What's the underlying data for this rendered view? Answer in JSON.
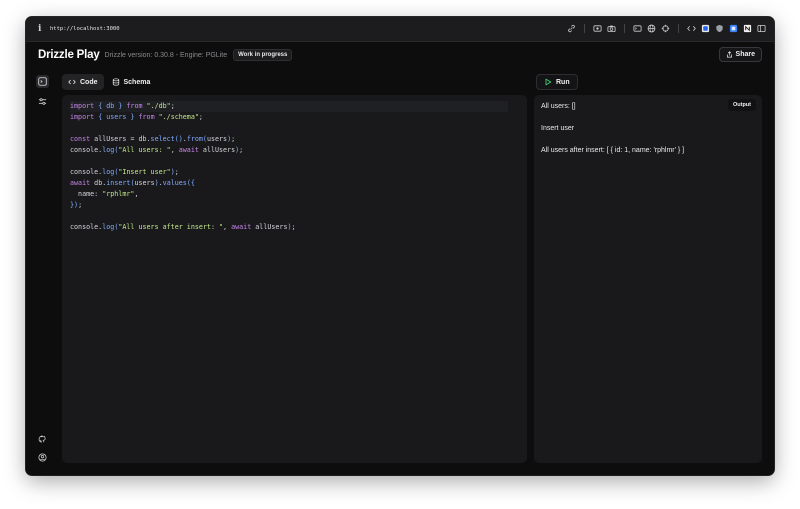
{
  "browser": {
    "url": "http://localhost:3000",
    "info_symbol": "i"
  },
  "header": {
    "brand": "Drizzle Play",
    "version_text": "Drizzle version: 0.30.8 - Engine: PGLite",
    "badge": "Work in progress",
    "share_label": "Share"
  },
  "tabs": [
    {
      "label": "Code",
      "icon": "code-brackets-icon",
      "active": true
    },
    {
      "label": "Schema",
      "icon": "database-icon",
      "active": false
    }
  ],
  "run_label": "Run",
  "editor": {
    "lines": [
      [
        [
          "kw",
          "import "
        ],
        [
          "br",
          "{ "
        ],
        [
          "fn",
          "db"
        ],
        [
          "br",
          " } "
        ],
        [
          "kw",
          "from "
        ],
        [
          "str",
          "\"./db\""
        ],
        [
          "plain",
          ";"
        ]
      ],
      [
        [
          "kw",
          "import "
        ],
        [
          "br",
          "{ "
        ],
        [
          "fn",
          "users"
        ],
        [
          "br",
          " } "
        ],
        [
          "kw",
          "from "
        ],
        [
          "str",
          "\"./schema\""
        ],
        [
          "plain",
          ";"
        ]
      ],
      [],
      [
        [
          "kw",
          "const "
        ],
        [
          "plain",
          "allUsers = db."
        ],
        [
          "fn",
          "select"
        ],
        [
          "br",
          "()"
        ],
        [
          "plain",
          "."
        ],
        [
          "fn",
          "from"
        ],
        [
          "br",
          "("
        ],
        [
          "plain",
          "users"
        ],
        [
          "br",
          ")"
        ],
        [
          "plain",
          ";"
        ]
      ],
      [
        [
          "plain",
          "console."
        ],
        [
          "fn",
          "log"
        ],
        [
          "br",
          "("
        ],
        [
          "str",
          "\"All users: \""
        ],
        [
          "plain",
          ", "
        ],
        [
          "kw",
          "await "
        ],
        [
          "plain",
          "allUsers"
        ],
        [
          "br",
          ")"
        ],
        [
          "plain",
          ";"
        ]
      ],
      [],
      [
        [
          "plain",
          "console."
        ],
        [
          "fn",
          "log"
        ],
        [
          "br",
          "("
        ],
        [
          "str",
          "\"Insert user\""
        ],
        [
          "br",
          ")"
        ],
        [
          "plain",
          ";"
        ]
      ],
      [
        [
          "kw",
          "await "
        ],
        [
          "plain",
          "db."
        ],
        [
          "fn",
          "insert"
        ],
        [
          "br",
          "("
        ],
        [
          "plain",
          "users"
        ],
        [
          "br",
          ")"
        ],
        [
          "plain",
          "."
        ],
        [
          "fn",
          "values"
        ],
        [
          "br",
          "({"
        ]
      ],
      [
        [
          "plain",
          "  name: "
        ],
        [
          "str",
          "\"rphlmr\""
        ],
        [
          "plain",
          ","
        ]
      ],
      [
        [
          "br",
          "})"
        ],
        [
          "plain",
          ";"
        ]
      ],
      [],
      [
        [
          "plain",
          "console."
        ],
        [
          "fn",
          "log"
        ],
        [
          "br",
          "("
        ],
        [
          "str",
          "\"All users after insert: \""
        ],
        [
          "plain",
          ", "
        ],
        [
          "kw",
          "await "
        ],
        [
          "plain",
          "allUsers"
        ],
        [
          "br",
          ")"
        ],
        [
          "plain",
          ";"
        ]
      ]
    ]
  },
  "output": {
    "badge": "Output",
    "lines": [
      "All users: []",
      "Insert user",
      "All users after insert: [ { id: 1, name: 'rphlmr' } ]"
    ]
  },
  "colors": {
    "keyword": "#c586ea",
    "function": "#82aaff",
    "string": "#c3e88d",
    "run_icon": "#4ade80"
  }
}
